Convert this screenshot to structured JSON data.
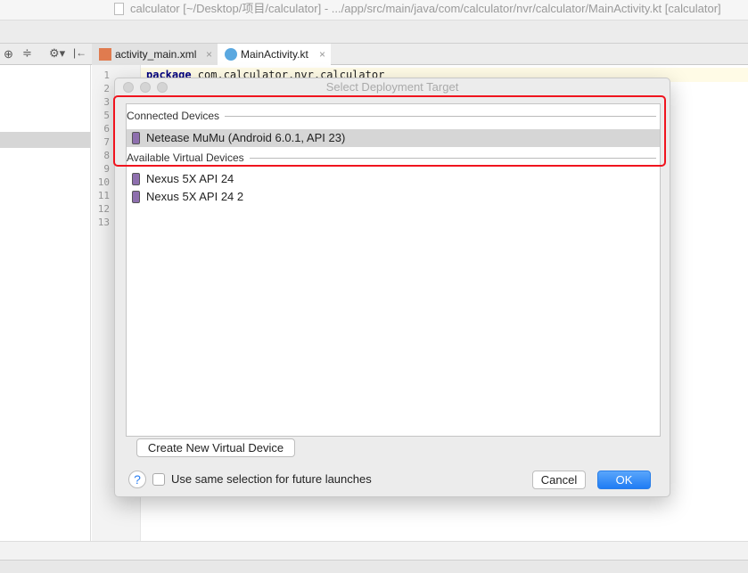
{
  "window": {
    "title": "calculator [~/Desktop/项目/calculator] - .../app/src/main/java/com/calculator/nvr/calculator/MainActivity.kt [calculator]"
  },
  "tabs": [
    {
      "label": "activity_main.xml",
      "icon": "xml-file-icon",
      "active": false
    },
    {
      "label": "MainActivity.kt",
      "icon": "kotlin-class-icon",
      "active": true
    }
  ],
  "editor": {
    "line_numbers": [
      "1",
      "2",
      "3",
      "5",
      "6",
      "7",
      "8",
      "9",
      "10",
      "11",
      "12",
      "13"
    ],
    "first_line": {
      "keyword": "package",
      "rest": " com.calculator.nvr.calculator"
    }
  },
  "dialog": {
    "title": "Select Deployment Target",
    "connected_header": "Connected Devices",
    "connected": [
      {
        "label": "Netease MuMu (Android 6.0.1, API 23)",
        "selected": true
      }
    ],
    "virtual_header": "Available Virtual Devices",
    "virtual": [
      {
        "label": "Nexus 5X API 24"
      },
      {
        "label": "Nexus 5X API 24 2"
      }
    ],
    "create_button": "Create New Virtual Device",
    "help": "?",
    "checkbox_label": "Use same selection for future launches",
    "checkbox_checked": false,
    "cancel": "Cancel",
    "ok": "OK",
    "highlight_color": "#f0141e",
    "ok_color": "#3a8ef6"
  }
}
